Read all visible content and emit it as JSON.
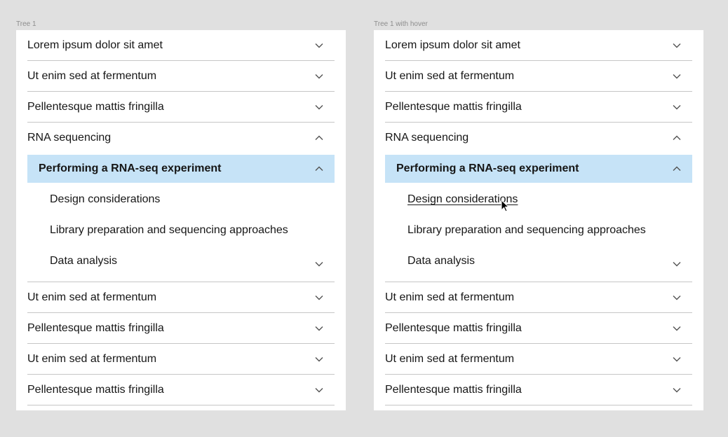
{
  "frames": [
    {
      "label": "Tree 1",
      "items": [
        {
          "label": "Lorem ipsum dolor sit amet",
          "chevron": "chevron-down"
        },
        {
          "label": "Ut enim sed at fermentum",
          "chevron": "chevron-down"
        },
        {
          "label": "Pellentesque mattis fringilla",
          "chevron": "chevron-down"
        },
        {
          "label": "RNA sequencing",
          "chevron": "chevron-up",
          "expanded": true
        },
        {
          "label": "Performing a RNA-seq experiment",
          "chevron": "chevron-up",
          "level": 1,
          "selected": true
        },
        {
          "label": "Design considerations",
          "level": 2
        },
        {
          "label": "Library preparation and sequencing approaches",
          "level": 2
        },
        {
          "label": "Data analysis",
          "level": 2,
          "chevron": "chevron-down"
        },
        {
          "label": "Ut enim sed at fermentum",
          "chevron": "chevron-down"
        },
        {
          "label": "Pellentesque mattis fringilla",
          "chevron": "chevron-down"
        },
        {
          "label": "Ut enim sed at fermentum",
          "chevron": "chevron-down"
        },
        {
          "label": "Pellentesque mattis fringilla",
          "chevron": "chevron-down"
        }
      ]
    },
    {
      "label": "Tree 1 with hover",
      "items": [
        {
          "label": "Lorem ipsum dolor sit amet",
          "chevron": "chevron-down"
        },
        {
          "label": "Ut enim sed at fermentum",
          "chevron": "chevron-down"
        },
        {
          "label": "Pellentesque mattis fringilla",
          "chevron": "chevron-down"
        },
        {
          "label": "RNA sequencing",
          "chevron": "chevron-up",
          "expanded": true
        },
        {
          "label": "Performing a RNA-seq experiment",
          "chevron": "chevron-up",
          "level": 1,
          "selected": true
        },
        {
          "label": "Design considerations",
          "level": 2,
          "hovered": true
        },
        {
          "label": "Library preparation and sequencing approaches",
          "level": 2
        },
        {
          "label": "Data analysis",
          "level": 2,
          "chevron": "chevron-down"
        },
        {
          "label": "Ut enim sed at fermentum",
          "chevron": "chevron-down"
        },
        {
          "label": "Pellentesque mattis fringilla",
          "chevron": "chevron-down"
        },
        {
          "label": "Ut enim sed at fermentum",
          "chevron": "chevron-down"
        },
        {
          "label": "Pellentesque mattis fringilla",
          "chevron": "chevron-down"
        }
      ]
    }
  ],
  "colors": {
    "page_bg": "#e0e0e0",
    "panel_bg": "#ffffff",
    "selected_bg": "#c6e3f7",
    "divider": "#c6c6c6",
    "chevron": "#525252",
    "frame_label": "#8d8d8d"
  }
}
